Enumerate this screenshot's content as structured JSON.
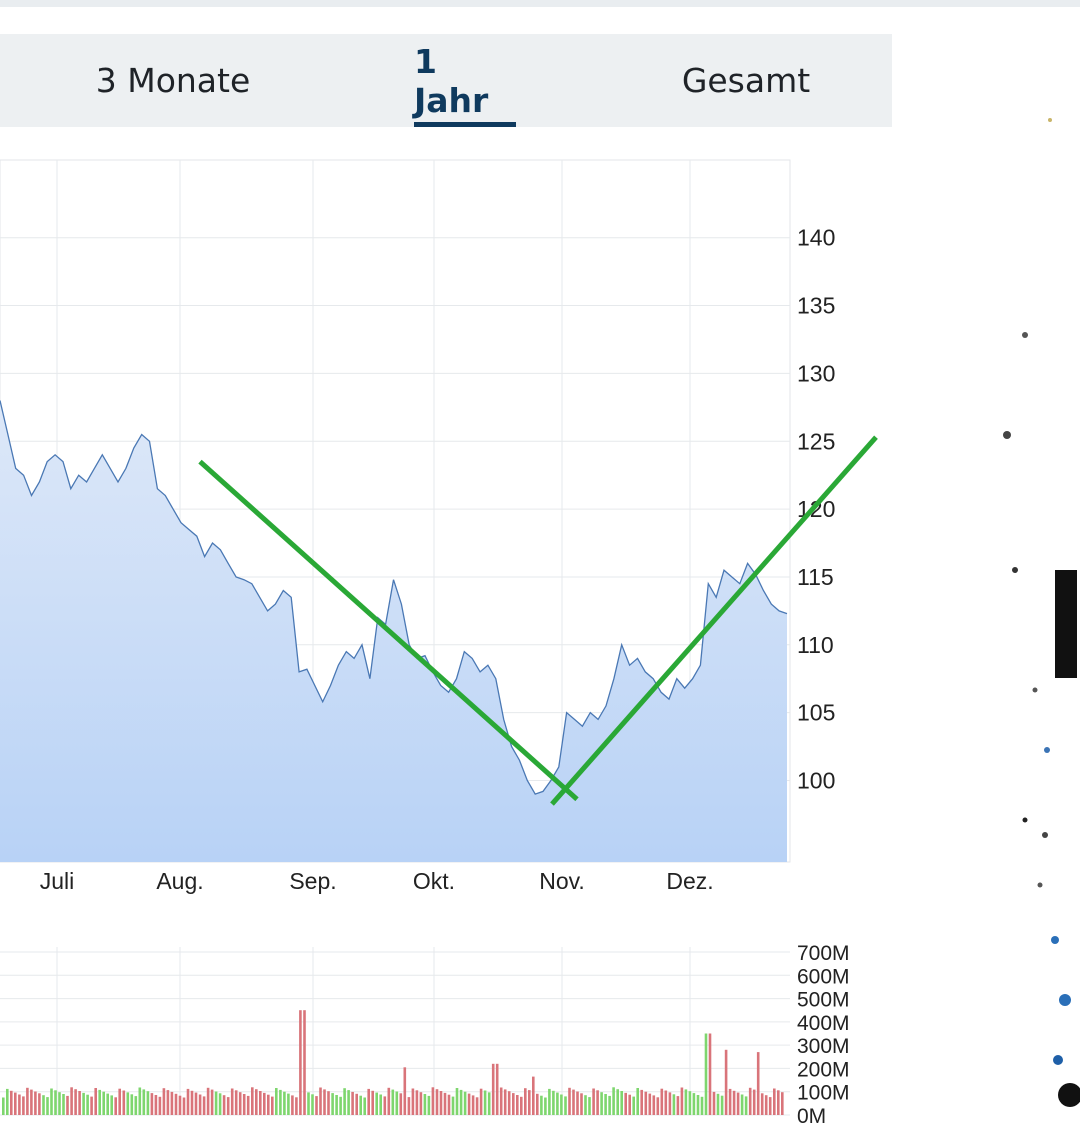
{
  "tabs": [
    {
      "label": "3 Monate",
      "active": false
    },
    {
      "label": "1 Jahr",
      "active": true
    },
    {
      "label": "Gesamt",
      "active": false
    }
  ],
  "chart_data": [
    {
      "type": "area",
      "title": "",
      "x_months": [
        "Juli",
        "Aug.",
        "Sep.",
        "Okt.",
        "Nov.",
        "Dez."
      ],
      "ylim": [
        95,
        143
      ],
      "yticks": [
        100,
        105,
        110,
        115,
        120,
        125,
        130,
        135,
        140
      ],
      "grid": true,
      "series": [
        {
          "values": [
            128,
            125.5,
            123,
            122.5,
            121,
            122,
            123.5,
            124,
            123.5,
            121.5,
            122.5,
            122,
            123,
            124,
            123,
            122,
            123,
            124.5,
            125.5,
            125,
            121.5,
            121,
            120,
            119,
            118.5,
            118,
            116.5,
            117.5,
            117,
            116,
            115,
            114.8,
            114.5,
            113.5,
            112.5,
            113,
            114,
            113.5,
            108,
            108.2,
            107,
            105.8,
            107,
            108.5,
            109.5,
            109,
            110,
            107.5,
            112,
            111.5,
            114.8,
            113,
            110,
            109,
            109.2,
            108,
            107,
            106.5,
            107.5,
            109.5,
            109,
            108,
            108.5,
            107.5,
            104.5,
            102.5,
            101.5,
            100,
            99,
            99.2,
            100,
            101,
            105,
            104.5,
            104,
            105,
            104.5,
            105.5,
            107.5,
            110,
            108.5,
            109,
            108,
            107.5,
            106.5,
            106,
            107.5,
            106.8,
            107.5,
            108.5,
            114.5,
            113.5,
            115.5,
            115,
            114.5,
            116,
            115.2,
            114,
            113,
            112.5,
            112.3
          ]
        }
      ]
    },
    {
      "type": "bar",
      "title": "",
      "ylim": [
        0,
        700
      ],
      "yticks": [
        "0M",
        "100M",
        "200M",
        "300M",
        "400M",
        "500M",
        "600M",
        "700M"
      ],
      "series": [
        {
          "name": "volume",
          "unit": "M"
        }
      ]
    }
  ],
  "annotations": {
    "trend_color": "#2aa836",
    "lines": [
      {
        "from": [
          "Aug.",
          123.5
        ],
        "to": [
          "Nov.",
          99.5
        ]
      },
      {
        "from": [
          "Nov.",
          99
        ],
        "to": [
          "Dez.",
          125.3
        ]
      }
    ]
  },
  "colors": {
    "area_top": "#dde8f8",
    "area_bottom": "#b8d2f6",
    "line": "#4a78b4",
    "up_bar": "#7ed66e",
    "down_bar": "#d9747a"
  }
}
